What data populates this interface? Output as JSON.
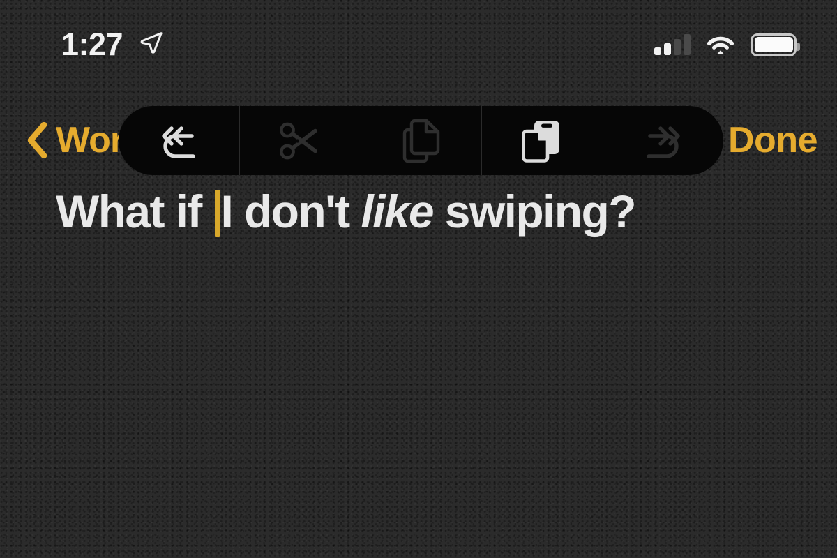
{
  "status_bar": {
    "time": "1:27",
    "location_icon": "location-arrow-icon",
    "cellular": {
      "icon": "cellular-signal-icon",
      "bars_total": 4,
      "bars_active": 2
    },
    "wifi": {
      "icon": "wifi-icon",
      "strength": "full"
    },
    "battery": {
      "icon": "battery-icon",
      "level_percent": 100
    }
  },
  "nav_bar": {
    "back": {
      "icon": "chevron-left-icon",
      "label": "Wor"
    },
    "done_label": "Done"
  },
  "edit_toolbar": {
    "items": [
      {
        "name": "undo",
        "icon": "undo-icon",
        "enabled": true
      },
      {
        "name": "cut",
        "icon": "scissors-icon",
        "enabled": false
      },
      {
        "name": "copy",
        "icon": "copy-icon",
        "enabled": false
      },
      {
        "name": "paste",
        "icon": "paste-icon",
        "enabled": true
      },
      {
        "name": "redo",
        "icon": "redo-icon",
        "enabled": false
      }
    ]
  },
  "note": {
    "text_before_caret": "What if ",
    "caret": "|",
    "text_plain_1": "I don't ",
    "text_italic": "like",
    "text_plain_2": " swiping?",
    "full_text": "What if I don't like swiping?"
  },
  "colors": {
    "background": "#2b2b2b",
    "toolbar_background": "#060606",
    "accent_yellow": "#e5ab2e",
    "caret_yellow": "#d8a82b",
    "text_primary": "#e9e9e9",
    "icon_enabled": "#dcdcdc",
    "icon_disabled": "#2e2e2e"
  }
}
